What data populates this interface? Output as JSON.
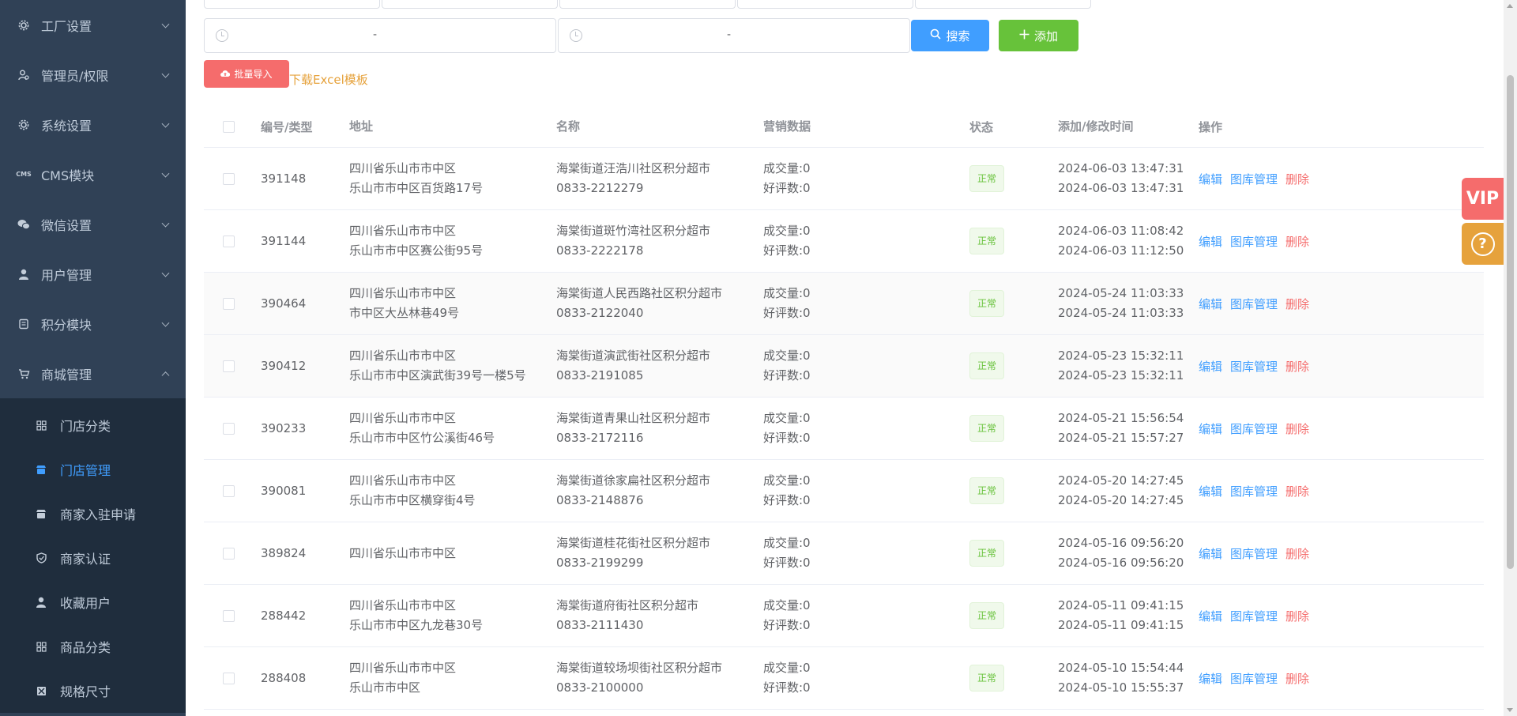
{
  "sidebar": {
    "menus": [
      {
        "label": "工厂设置",
        "icon": "gear-icon"
      },
      {
        "label": "管理员/权限",
        "icon": "admin-icon"
      },
      {
        "label": "系统设置",
        "icon": "gear-icon"
      },
      {
        "label": "CMS模块",
        "icon": "cms-icon"
      },
      {
        "label": "微信设置",
        "icon": "wechat-icon"
      },
      {
        "label": "用户管理",
        "icon": "user-icon"
      },
      {
        "label": "积分模块",
        "icon": "points-icon"
      },
      {
        "label": "商城管理",
        "icon": "shop-icon"
      }
    ],
    "cms_badge": "CMS",
    "submenu": [
      {
        "label": "门店分类",
        "icon": "grid-icon"
      },
      {
        "label": "门店管理",
        "icon": "store-icon"
      },
      {
        "label": "商家入驻申请",
        "icon": "store-icon"
      },
      {
        "label": "商家认证",
        "icon": "shield-icon"
      },
      {
        "label": "收藏用户",
        "icon": "user-icon"
      },
      {
        "label": "商品分类",
        "icon": "grid-icon"
      },
      {
        "label": "规格尺寸",
        "icon": "size-icon"
      }
    ]
  },
  "toolbar": {
    "range_separator": "-",
    "search_label": "搜索",
    "add_label": "添加",
    "import_label": "批量导入",
    "excel_link": "下载Excel模板"
  },
  "table": {
    "headers": {
      "id": "编号/类型",
      "address": "地址",
      "name": "名称",
      "marketing": "营销数据",
      "status": "状态",
      "time": "添加/修改时间",
      "ops": "操作"
    },
    "ops": {
      "edit": "编辑",
      "gallery": "图库管理",
      "delete": "删除"
    },
    "rows": [
      {
        "id": "391148",
        "addr1": "四川省乐山市市中区",
        "addr2": "乐山市市中区百货路17号",
        "name1": "海棠街道汪浩川社区积分超市",
        "name2": "0833-2212279",
        "sales": "成交量:0",
        "reviews": "好评数:0",
        "status": "正常",
        "t1": "2024-06-03 13:47:31",
        "t2": "2024-06-03 13:47:31"
      },
      {
        "id": "391144",
        "addr1": "四川省乐山市市中区",
        "addr2": "乐山市市中区赛公街95号",
        "name1": "海棠街道斑竹湾社区积分超市",
        "name2": "0833-2222178",
        "sales": "成交量:0",
        "reviews": "好评数:0",
        "status": "正常",
        "t1": "2024-06-03 11:08:42",
        "t2": "2024-06-03 11:12:50"
      },
      {
        "id": "390464",
        "addr1": "四川省乐山市市中区",
        "addr2": "市中区大丛林巷49号",
        "name1": "海棠街道人民西路社区积分超市",
        "name2": "0833-2122040",
        "sales": "成交量:0",
        "reviews": "好评数:0",
        "status": "正常",
        "t1": "2024-05-24 11:03:33",
        "t2": "2024-05-24 11:03:33"
      },
      {
        "id": "390412",
        "addr1": "四川省乐山市市中区",
        "addr2": "乐山市市中区演武街39号一楼5号",
        "name1": "海棠街道演武街社区积分超市",
        "name2": "0833-2191085",
        "sales": "成交量:0",
        "reviews": "好评数:0",
        "status": "正常",
        "t1": "2024-05-23 15:32:11",
        "t2": "2024-05-23 15:32:11"
      },
      {
        "id": "390233",
        "addr1": "四川省乐山市市中区",
        "addr2": "乐山市市中区竹公溪街46号",
        "name1": "海棠街道青果山社区积分超市",
        "name2": "0833-2172116",
        "sales": "成交量:0",
        "reviews": "好评数:0",
        "status": "正常",
        "t1": "2024-05-21 15:56:54",
        "t2": "2024-05-21 15:57:27"
      },
      {
        "id": "390081",
        "addr1": "四川省乐山市市中区",
        "addr2": "乐山市市中区横穿街4号",
        "name1": "海棠街道徐家扁社区积分超市",
        "name2": "0833-2148876",
        "sales": "成交量:0",
        "reviews": "好评数:0",
        "status": "正常",
        "t1": "2024-05-20 14:27:45",
        "t2": "2024-05-20 14:27:45"
      },
      {
        "id": "389824",
        "addr1": "四川省乐山市市中区",
        "addr2": "",
        "name1": "海棠街道桂花街社区积分超市",
        "name2": "0833-2199299",
        "sales": "成交量:0",
        "reviews": "好评数:0",
        "status": "正常",
        "t1": "2024-05-16 09:56:20",
        "t2": "2024-05-16 09:56:20"
      },
      {
        "id": "288442",
        "addr1": "四川省乐山市市中区",
        "addr2": "乐山市市中区九龙巷30号",
        "name1": "海棠街道府街社区积分超市",
        "name2": "0833-2111430",
        "sales": "成交量:0",
        "reviews": "好评数:0",
        "status": "正常",
        "t1": "2024-05-11 09:41:15",
        "t2": "2024-05-11 09:41:15"
      },
      {
        "id": "288408",
        "addr1": "四川省乐山市市中区",
        "addr2": "乐山市市中区",
        "name1": "海棠街道较场坝街社区积分超市",
        "name2": "0833-2100000",
        "sales": "成交量:0",
        "reviews": "好评数:0",
        "status": "正常",
        "t1": "2024-05-10 15:54:44",
        "t2": "2024-05-10 15:55:37"
      }
    ]
  },
  "floating": {
    "vip_label": "VIP",
    "help_label": "?"
  },
  "colors": {
    "sidebar_bg": "#304156",
    "submenu_bg": "#1f2d3d",
    "primary": "#409eff",
    "success": "#67c23a",
    "danger": "#f56c6c",
    "warning": "#e6a23c"
  }
}
